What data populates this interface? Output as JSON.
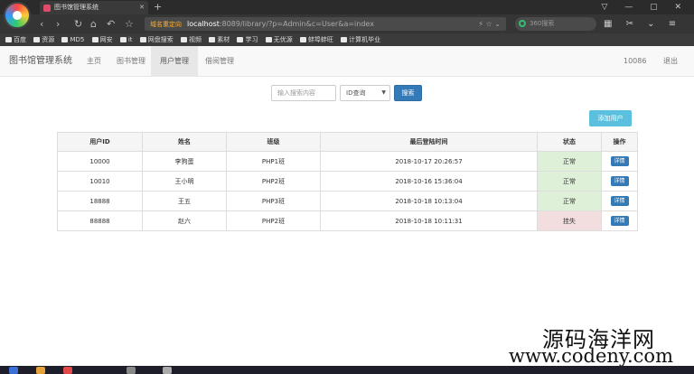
{
  "browser": {
    "tab_title": "图书馆管理系统",
    "tab_close": "✕",
    "new_tab": "+",
    "window_controls": "▽ — ▢ ✕",
    "nav_back": "‹",
    "nav_forward": "›",
    "nav_reload": "↻",
    "nav_home": "⌂",
    "nav_undo": "↶",
    "nav_star": "☆",
    "url_warning": "域名重定向",
    "url_host": "localhost",
    "url_path": ":8089/library/?p=Admin&c=User&a=index",
    "url_icons": "⚡ ☆ ⌄",
    "search_placeholder": "360搜索",
    "right_tools": "▦ ✂ ⌄ ≡",
    "bookmarks": [
      "百度",
      "资源",
      "MD5",
      "网安",
      "it",
      "网盘搜索",
      "视频",
      "素材",
      "学习",
      "无优源",
      "蚌埠蚌旺",
      "计算机毕业"
    ]
  },
  "app": {
    "brand": "图书馆管理系统",
    "nav": {
      "home": "主页",
      "books": "图书管理",
      "users": "用户管理",
      "borrow": "借阅管理"
    },
    "current_user": "10086",
    "logout": "退出"
  },
  "search": {
    "placeholder": "输入搜索内容",
    "type_selected": "ID查询",
    "button": "搜索"
  },
  "add_user_button": "添加用户",
  "table": {
    "headers": [
      "用户ID",
      "姓名",
      "班级",
      "最后登陆时间",
      "状态",
      "操作"
    ],
    "rows": [
      {
        "id": "10000",
        "name": "李狗蛋",
        "class": "PHP1班",
        "last_login": "2018-10-17 20:26:57",
        "status": "正常",
        "action": "详情"
      },
      {
        "id": "10010",
        "name": "王小明",
        "class": "PHP2班",
        "last_login": "2018-10-16 15:36:04",
        "status": "正常",
        "action": "详情"
      },
      {
        "id": "18888",
        "name": "王五",
        "class": "PHP3班",
        "last_login": "2018-10-18 10:13:04",
        "status": "正常",
        "action": "详情"
      },
      {
        "id": "88888",
        "name": "赵六",
        "class": "PHP2班",
        "last_login": "2018-10-18 10:11:31",
        "status": "挂失",
        "action": "详情"
      }
    ]
  },
  "watermark": {
    "cn": "源码海洋网",
    "url": "www.codeny.com"
  },
  "colors": {
    "primary": "#337ab7",
    "info": "#5bc0de",
    "status_ok_bg": "#dff0d8",
    "status_lost_bg": "#f2dede"
  }
}
